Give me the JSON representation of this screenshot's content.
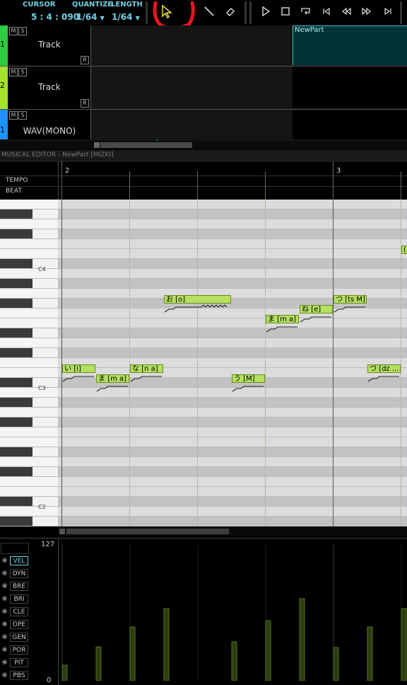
{
  "toolbar": {
    "cursor_label": "CURSOR",
    "cursor_value": "5 : 4 : 090",
    "quantize_label": "QUANTIZE",
    "quantize_value": "1/64",
    "length_label": "LENGTH",
    "length_value": "1/64"
  },
  "tracks": [
    {
      "number": "1",
      "name": "Track",
      "color": "#2ecc40",
      "mute": "M",
      "solo": "S",
      "r": "R"
    },
    {
      "number": "2",
      "name": "Track",
      "color": "#a6e22e",
      "mute": "M",
      "solo": "S",
      "r": "R"
    },
    {
      "number": "1",
      "name": "WAV(MONO)",
      "color": "#1e90ff",
      "mute": "M",
      "solo": "S"
    }
  ],
  "part": {
    "name": "NewPart"
  },
  "editor": {
    "title": "MUSICAL EDITOR - NewPart [MIZKI]",
    "tempo_label": "TEMPO",
    "beat_label": "BEAT",
    "measure_2": "2",
    "measure_3": "3",
    "octave_c4": "C4",
    "octave_c3": "C3",
    "octave_c2": "C2"
  },
  "notes": [
    {
      "lyric": "い [i]"
    },
    {
      "lyric": "ま [m a]"
    },
    {
      "lyric": "な [n a]"
    },
    {
      "lyric": "お [o]"
    },
    {
      "lyric": "う [M]"
    },
    {
      "lyric": "ま [m a]"
    },
    {
      "lyric": "ね [e]"
    },
    {
      "lyric": "つ [ts M]"
    },
    {
      "lyric": "づ [dz ..."
    },
    {
      "lyric": "("
    }
  ],
  "control": {
    "max_value": "127",
    "min_value": "0",
    "params": [
      "VEL",
      "DYN",
      "BRE",
      "BRI",
      "CLE",
      "OPE",
      "GEN",
      "POR",
      "PIT",
      "PBS"
    ],
    "active": "VEL"
  }
}
